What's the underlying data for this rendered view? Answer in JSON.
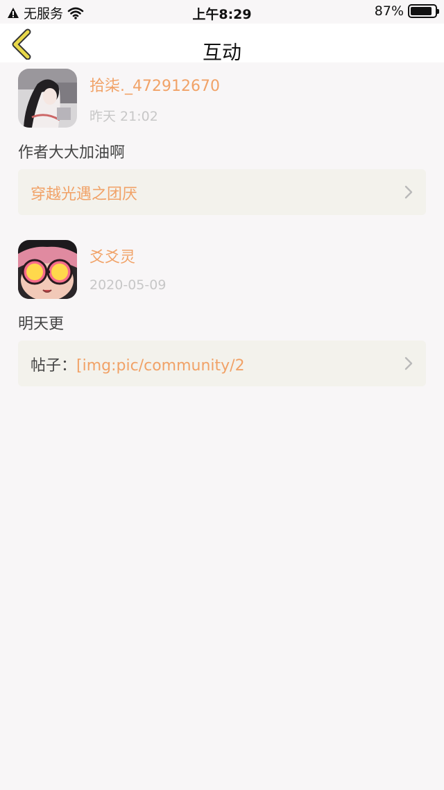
{
  "status_bar": {
    "carrier": "无服务",
    "time": "上午8:29",
    "battery_percent": "87%",
    "battery_level": 0.87
  },
  "nav": {
    "title": "互动",
    "back_icon": "chevron-left-icon"
  },
  "items": [
    {
      "username": "拾柒._472912670",
      "time": "昨天 21:02",
      "comment": "作者大大加油啊",
      "ref_label": "",
      "ref_title": "穿越光遇之团厌",
      "avatar_icon": "user-photo-avatar"
    },
    {
      "username": "爻爻灵",
      "time": "2020-05-09",
      "comment": "明天更",
      "ref_label": "帖子：",
      "ref_title": "[img:pic/community/2",
      "avatar_icon": "anime-girl-avatar"
    }
  ],
  "colors": {
    "accent": "#f1a267",
    "background": "#f8f6f7",
    "card": "#f3f2ec",
    "muted": "#c7c7c7",
    "back_arrow": "#e8d84a"
  }
}
